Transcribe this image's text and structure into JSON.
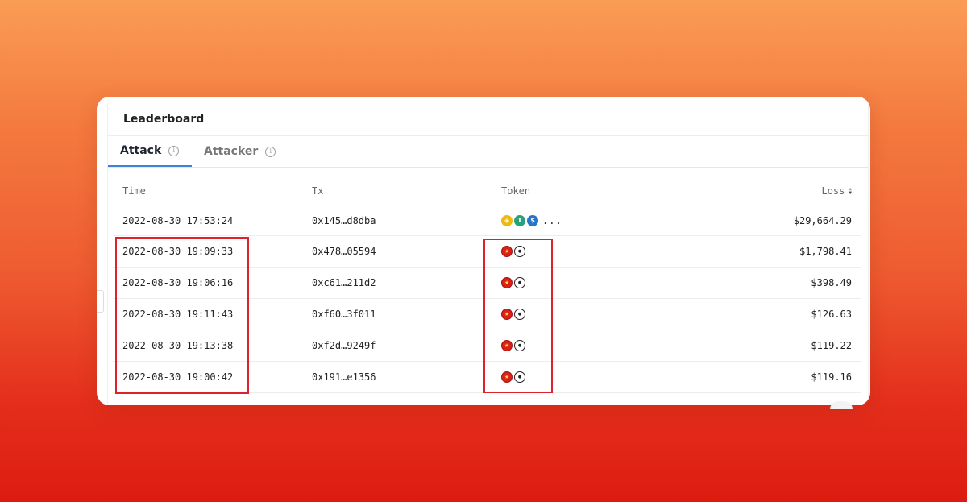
{
  "title": "Leaderboard",
  "tabs": [
    {
      "label": "Attack",
      "active": true
    },
    {
      "label": "Attacker",
      "active": false
    }
  ],
  "columns": {
    "time": "Time",
    "tx": "Tx",
    "token": "Token",
    "loss": "Loss"
  },
  "rows": [
    {
      "time": "2022-08-30 17:53:24",
      "tx": "0x145…d8dba",
      "tokens": [
        "bnb-icon",
        "usdt-icon",
        "usdc-icon"
      ],
      "more": "...",
      "loss": "$29,664.29"
    },
    {
      "time": "2022-08-30 19:09:33",
      "tx": "0x478…05594",
      "tokens": [
        "red-token-icon",
        "wbnb-icon"
      ],
      "loss": "$1,798.41"
    },
    {
      "time": "2022-08-30 19:06:16",
      "tx": "0xc61…211d2",
      "tokens": [
        "red-token-icon",
        "wbnb-icon"
      ],
      "loss": "$398.49"
    },
    {
      "time": "2022-08-30 19:11:43",
      "tx": "0xf60…3f011",
      "tokens": [
        "red-token-icon",
        "wbnb-icon"
      ],
      "loss": "$126.63"
    },
    {
      "time": "2022-08-30 19:13:38",
      "tx": "0xf2d…9249f",
      "tokens": [
        "red-token-icon",
        "wbnb-icon"
      ],
      "loss": "$119.22"
    },
    {
      "time": "2022-08-30 19:00:42",
      "tx": "0x191…e1356",
      "tokens": [
        "red-token-icon",
        "wbnb-icon"
      ],
      "loss": "$119.16"
    }
  ],
  "colors": {
    "tx_link": "#3aa67a",
    "tab_active_underline": "#3b82d9",
    "highlight_box": "#e0202a",
    "background_top": "#fa9c55",
    "background_bottom": "#dd1b10"
  }
}
